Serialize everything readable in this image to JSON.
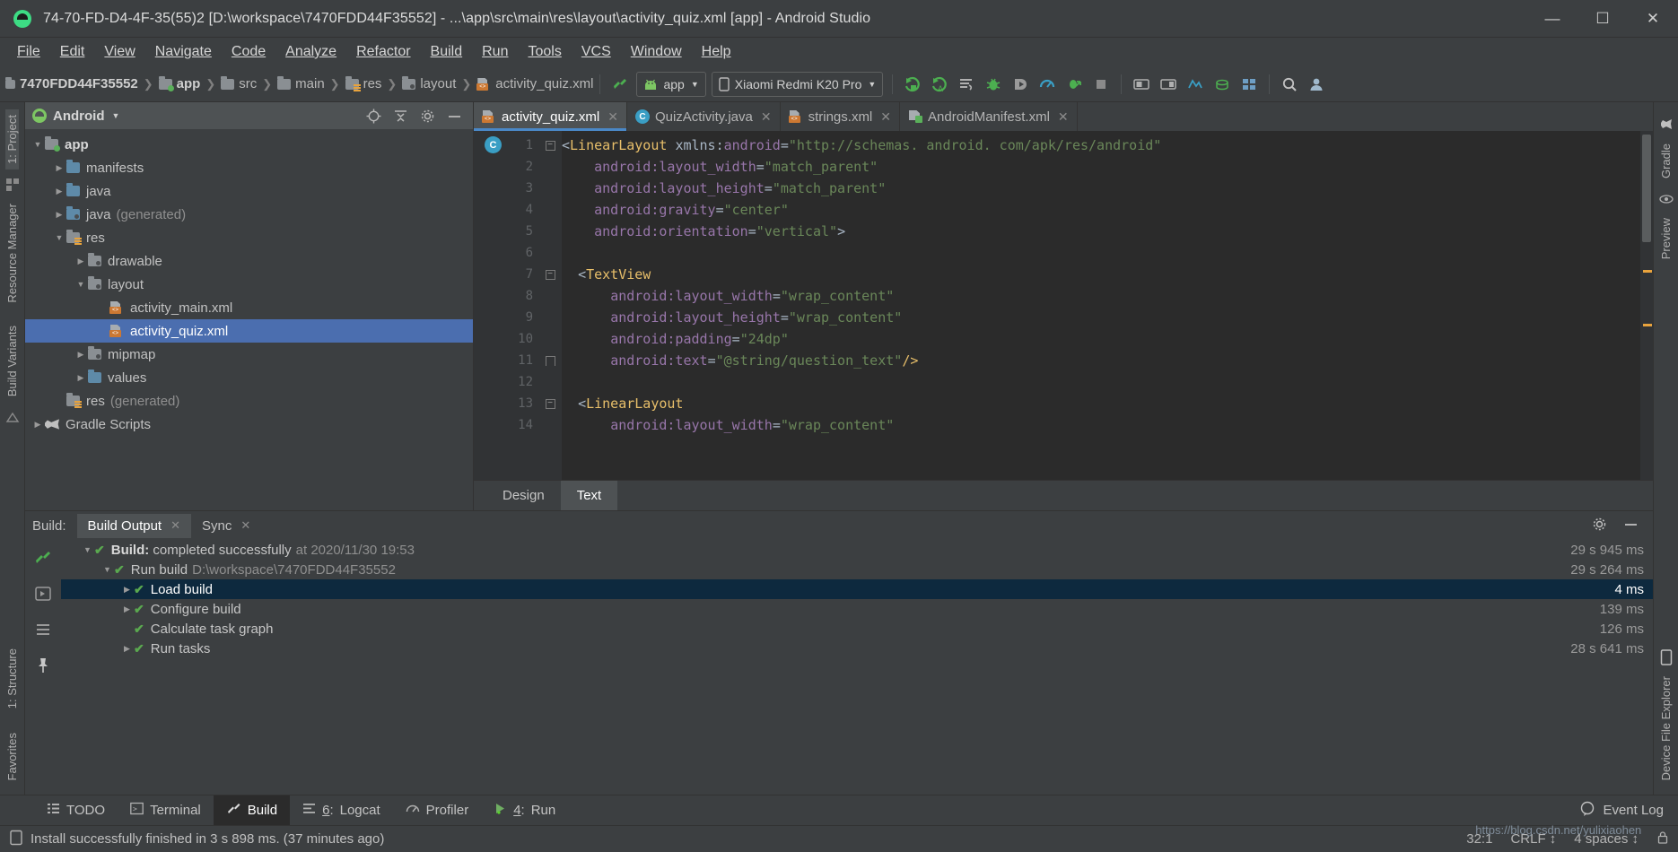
{
  "window": {
    "title": "74-70-FD-D4-4F-35(55)2 [D:\\workspace\\7470FDD44F35552] - ...\\app\\src\\main\\res\\layout\\activity_quiz.xml [app] - Android Studio",
    "minimize": "—",
    "maximize": "☐",
    "close": "✕",
    "app_icon": "android-robot-icon"
  },
  "menubar": [
    {
      "label": "File"
    },
    {
      "label": "Edit"
    },
    {
      "label": "View"
    },
    {
      "label": "Navigate"
    },
    {
      "label": "Code"
    },
    {
      "label": "Analyze"
    },
    {
      "label": "Refactor"
    },
    {
      "label": "Build"
    },
    {
      "label": "Run"
    },
    {
      "label": "Tools"
    },
    {
      "label": "VCS"
    },
    {
      "label": "Window"
    },
    {
      "label": "Help"
    }
  ],
  "toolbar": {
    "breadcrumbs": [
      {
        "label": "7470FDD44F35552",
        "icon": "module-icon"
      },
      {
        "label": "app",
        "icon": "folder-green-icon"
      },
      {
        "label": "src",
        "icon": "folder-icon"
      },
      {
        "label": "main",
        "icon": "folder-icon"
      },
      {
        "label": "res",
        "icon": "folder-res-icon"
      },
      {
        "label": "layout",
        "icon": "folder-layout-icon"
      },
      {
        "label": "activity_quiz.xml",
        "icon": "xml-file-icon"
      }
    ],
    "separator": "❯",
    "build_button": "make-project-icon",
    "run_config": {
      "label": "app",
      "icon": "android-icon",
      "caret": "▼"
    },
    "device": {
      "label": "Xiaomi Redmi K20 Pro",
      "icon": "phone-icon",
      "caret": "▼"
    },
    "actions": [
      "run-icon",
      "run-with-coverage-icon",
      "apply-changes-icon",
      "debug-icon",
      "attach-debugger-icon",
      "profiler-icon",
      "apply-code-changes-icon",
      "stop-icon",
      "avd-manager-icon",
      "sdk-manager-icon",
      "layout-inspector-icon",
      "sync-gradle-icon",
      "project-structure-icon",
      "search-icon",
      "account-icon"
    ]
  },
  "left_rail": {
    "top": [
      {
        "label": "1: Project",
        "active": true
      }
    ],
    "middle": [
      {
        "label": "Resource Manager"
      },
      {
        "label": "Build Variants"
      }
    ],
    "bottom": [
      {
        "label": "1: Structure"
      },
      {
        "label": "Favorites"
      }
    ]
  },
  "right_rail": {
    "items": [
      {
        "label": "Gradle"
      },
      {
        "label": "Preview"
      },
      {
        "label": "Device File Explorer"
      }
    ]
  },
  "project_panel": {
    "title": "Android",
    "caret": "▼",
    "tools": [
      "target-icon",
      "collapse-all-icon",
      "settings-icon",
      "hide-icon"
    ],
    "tree": [
      {
        "depth": 0,
        "arrow": "▼",
        "icon": "folder-green-icon",
        "label": "app",
        "bold": true,
        "selected": false,
        "dim": ""
      },
      {
        "depth": 1,
        "arrow": "▶",
        "icon": "folder-icon",
        "label": "manifests",
        "bold": false,
        "selected": false,
        "dim": ""
      },
      {
        "depth": 1,
        "arrow": "▶",
        "icon": "folder-icon",
        "label": "java",
        "bold": false,
        "selected": false,
        "dim": ""
      },
      {
        "depth": 1,
        "arrow": "▶",
        "icon": "folder-generated-icon",
        "label": "java",
        "bold": false,
        "selected": false,
        "dim": "(generated)"
      },
      {
        "depth": 1,
        "arrow": "▼",
        "icon": "folder-res-icon",
        "label": "res",
        "bold": false,
        "selected": false,
        "dim": ""
      },
      {
        "depth": 2,
        "arrow": "▶",
        "icon": "folder-layout-icon",
        "label": "drawable",
        "bold": false,
        "selected": false,
        "dim": ""
      },
      {
        "depth": 2,
        "arrow": "▼",
        "icon": "folder-layout-icon",
        "label": "layout",
        "bold": false,
        "selected": false,
        "dim": ""
      },
      {
        "depth": 3,
        "arrow": "",
        "icon": "xml-file-icon",
        "label": "activity_main.xml",
        "bold": false,
        "selected": false,
        "dim": ""
      },
      {
        "depth": 3,
        "arrow": "",
        "icon": "xml-file-icon",
        "label": "activity_quiz.xml",
        "bold": false,
        "selected": true,
        "dim": ""
      },
      {
        "depth": 2,
        "arrow": "▶",
        "icon": "folder-layout-icon",
        "label": "mipmap",
        "bold": false,
        "selected": false,
        "dim": ""
      },
      {
        "depth": 2,
        "arrow": "▶",
        "icon": "folder-icon",
        "label": "values",
        "bold": false,
        "selected": false,
        "dim": ""
      },
      {
        "depth": 1,
        "arrow": "",
        "icon": "folder-icon",
        "label": "res",
        "bold": false,
        "selected": false,
        "dim": "(generated)"
      },
      {
        "depth": 0,
        "arrow": "▶",
        "icon": "gradle-icon",
        "label": "Gradle Scripts",
        "bold": false,
        "selected": false,
        "dim": ""
      }
    ]
  },
  "editor": {
    "tabs": [
      {
        "label": "activity_quiz.xml",
        "icon": "xml-file-icon",
        "active": true,
        "close": "✕"
      },
      {
        "label": "QuizActivity.java",
        "icon": "java-class-icon",
        "active": false,
        "close": "✕"
      },
      {
        "label": "strings.xml",
        "icon": "xml-file-icon",
        "active": false,
        "close": "✕"
      },
      {
        "label": "AndroidManifest.xml",
        "icon": "manifest-file-icon",
        "active": false,
        "close": "✕"
      }
    ],
    "class_marker": "C",
    "lines": [
      {
        "n": "1",
        "fold": "minus",
        "html": "<span class='punct'>&lt;</span><span class='tag'>LinearLayout</span> <span class='punct'>xmlns:</span><span class='attr'>android</span><span class='eq'>=</span><span class='str'>\"http://schemas. android. com/apk/res/android\"</span>"
      },
      {
        "n": "2",
        "fold": "",
        "html": "    <span class='attr'>android:layout_width</span><span class='eq'>=</span><span class='str'>\"match_parent\"</span>"
      },
      {
        "n": "3",
        "fold": "",
        "html": "    <span class='attr'>android:layout_height</span><span class='eq'>=</span><span class='str'>\"match_parent\"</span>"
      },
      {
        "n": "4",
        "fold": "",
        "html": "    <span class='attr'>android:gravity</span><span class='eq'>=</span><span class='str'>\"center\"</span>"
      },
      {
        "n": "5",
        "fold": "",
        "html": "    <span class='attr'>android:orientation</span><span class='eq'>=</span><span class='str'>\"vertical\"</span><span class='punct'>&gt;</span>"
      },
      {
        "n": "6",
        "fold": "",
        "html": ""
      },
      {
        "n": "7",
        "fold": "minus",
        "html": "  <span class='punct'>&lt;</span><span class='tag'>TextView</span>"
      },
      {
        "n": "8",
        "fold": "",
        "html": "      <span class='attr'>android:layout_width</span><span class='eq'>=</span><span class='str'>\"wrap_content\"</span>"
      },
      {
        "n": "9",
        "fold": "",
        "html": "      <span class='attr'>android:layout_height</span><span class='eq'>=</span><span class='str'>\"wrap_content\"</span>"
      },
      {
        "n": "10",
        "fold": "",
        "html": "      <span class='attr'>android:padding</span><span class='eq'>=</span><span class='str'>\"24dp\"</span>"
      },
      {
        "n": "11",
        "fold": "end",
        "html": "      <span class='attr'>android:text</span><span class='eq'>=</span><span class='str'>\"@string/question_text\"</span><span class='tag'>/&gt;</span>"
      },
      {
        "n": "12",
        "fold": "",
        "html": ""
      },
      {
        "n": "13",
        "fold": "minus",
        "html": "  <span class='punct'>&lt;</span><span class='tag'>LinearLayout</span>"
      },
      {
        "n": "14",
        "fold": "",
        "html": "      <span class='attr'>android:layout_width</span><span class='eq'>=</span><span class='str'>\"wrap_content\"</span>"
      }
    ],
    "design_tabs": [
      {
        "label": "Design",
        "active": false
      },
      {
        "label": "Text",
        "active": true
      }
    ]
  },
  "build_panel": {
    "header_label": "Build:",
    "tabs": [
      {
        "label": "Build Output",
        "active": true,
        "close": "✕"
      },
      {
        "label": "Sync",
        "active": false,
        "close": "✕"
      }
    ],
    "settings_icon": "gear-icon",
    "hide_icon": "hide-icon",
    "rail_icons": [
      "build-hammer-icon",
      "restart-icon",
      "toggle-tasks-icon",
      "pin-icon"
    ],
    "rows": [
      {
        "depth": 0,
        "arrow": "▼",
        "check": "✔",
        "label": "Build:",
        "bold_label": true,
        "text": "completed successfully",
        "dim": "at 2020/11/30 19:53",
        "time": "29 s 945 ms",
        "selected": false
      },
      {
        "depth": 1,
        "arrow": "▼",
        "check": "✔",
        "label": "",
        "bold_label": false,
        "text": "Run build",
        "dim": "D:\\workspace\\7470FDD44F35552",
        "time": "29 s 264 ms",
        "selected": false
      },
      {
        "depth": 2,
        "arrow": "▶",
        "check": "✔",
        "label": "",
        "bold_label": false,
        "text": "Load build",
        "dim": "",
        "time": "4 ms",
        "selected": true
      },
      {
        "depth": 2,
        "arrow": "▶",
        "check": "✔",
        "label": "",
        "bold_label": false,
        "text": "Configure build",
        "dim": "",
        "time": "139 ms",
        "selected": false
      },
      {
        "depth": 2,
        "arrow": "",
        "check": "✔",
        "label": "",
        "bold_label": false,
        "text": "Calculate task graph",
        "dim": "",
        "time": "126 ms",
        "selected": false
      },
      {
        "depth": 2,
        "arrow": "▶",
        "check": "✔",
        "label": "",
        "bold_label": false,
        "text": "Run tasks",
        "dim": "",
        "time": "28 s 641 ms",
        "selected": false
      }
    ]
  },
  "tool_windows": [
    {
      "label": "TODO",
      "icon": "todo-icon",
      "active": false,
      "mnemonic": ""
    },
    {
      "label": "Terminal",
      "icon": "terminal-icon",
      "active": false,
      "mnemonic": ""
    },
    {
      "label": "Build",
      "icon": "hammer-icon",
      "active": true,
      "mnemonic": ""
    },
    {
      "label": "Logcat",
      "icon": "logcat-icon",
      "active": false,
      "mnemonic": "6"
    },
    {
      "label": "Profiler",
      "icon": "profiler-icon",
      "active": false,
      "mnemonic": ""
    },
    {
      "label": "Run",
      "icon": "run-icon",
      "active": false,
      "mnemonic": "4"
    }
  ],
  "event_log": {
    "label": "Event Log",
    "icon": "balloon-icon"
  },
  "statusbar": {
    "message": "Install successfully finished in 3 s 898 ms. (37 minutes ago)",
    "icon": "device-icon",
    "caret_position": "32:1",
    "line_separator": "CRLF",
    "line_separator_caret": "↕",
    "indent": "4 spaces",
    "indent_caret": "↕",
    "watermark": "https://blog.csdn.net/yulixiaohen"
  },
  "colors": {
    "accent_blue": "#4b6eaf",
    "selection_blue": "#0d293e",
    "android_green": "#3ddc84",
    "check_green": "#5aa94f",
    "editor_bg": "#2b2b2b",
    "chrome_bg": "#3c3f41"
  }
}
